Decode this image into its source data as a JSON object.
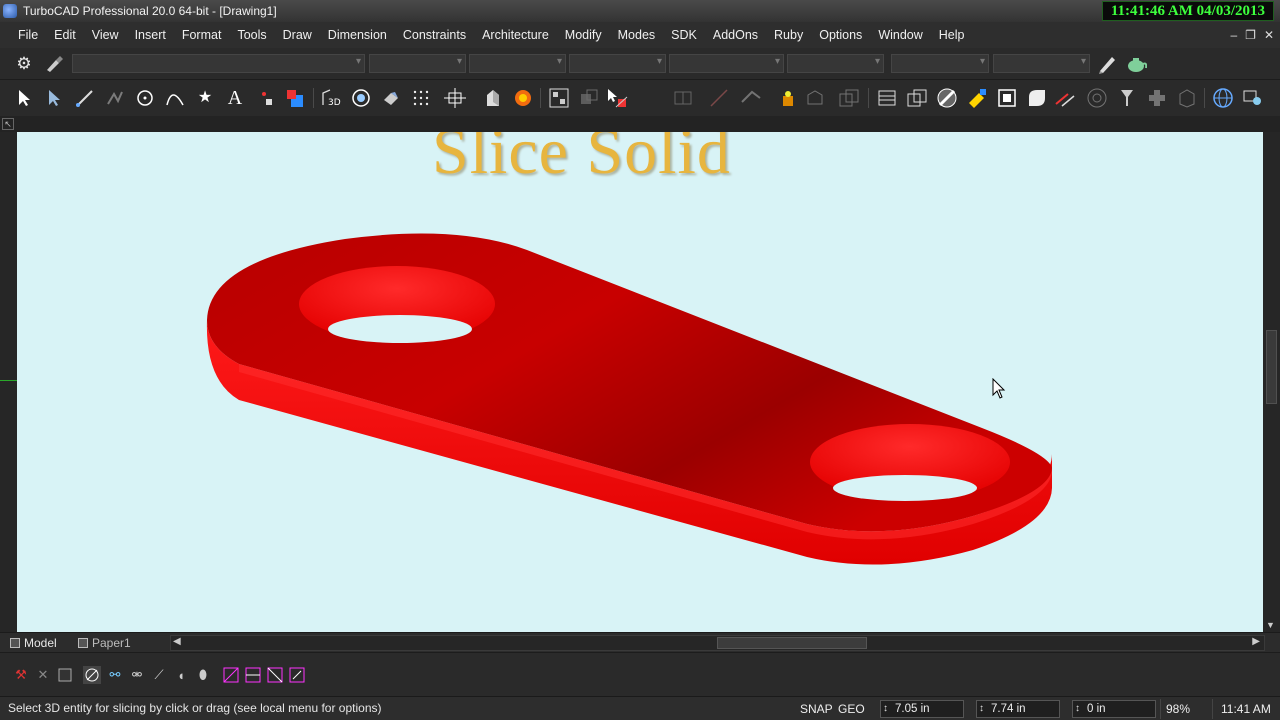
{
  "window": {
    "title": "TurboCAD Professional 20.0 64-bit - [Drawing1]"
  },
  "clock": {
    "text": "11:41:46 AM 04/03/2013"
  },
  "menu": [
    "File",
    "Edit",
    "View",
    "Insert",
    "Format",
    "Tools",
    "Draw",
    "Dimension",
    "Constraints",
    "Architecture",
    "Modify",
    "Modes",
    "SDK",
    "AddOns",
    "Ruby",
    "Options",
    "Window",
    "Help"
  ],
  "window_controls": {
    "minimize": "–",
    "restore": "❐",
    "close": "✕"
  },
  "overlay": {
    "caption": "Slice Solid"
  },
  "tabs": {
    "model": "Model",
    "paper": "Paper1"
  },
  "status": {
    "message": "Select 3D entity for slicing by click or drag (see local menu for options)",
    "snap": "SNAP",
    "geo": "GEO",
    "x": "7.05 in",
    "y": "7.74 in",
    "z": "0 in",
    "zoom": "98%",
    "time": "11:41 AM"
  },
  "colors": {
    "canvas": "#d8f3f6",
    "part": "#e60000",
    "caption": "#e7b53f",
    "clock_text": "#3dff3d"
  },
  "icons": {
    "property_toolbar": [
      "gear-icon",
      "brush-icon",
      "pencil-icon",
      "teapot-icon"
    ],
    "main_toolbar": [
      "select-arrow-icon",
      "edit-arrow-icon",
      "line-icon",
      "multiline-icon",
      "circle-icon",
      "curve-icon",
      "star-icon",
      "text-icon",
      "point-icon",
      "fill-icon",
      "view-3d-icon",
      "camera-target-icon",
      "render-icon",
      "grid-icon",
      "snap-icon",
      "shell-icon",
      "material-icon",
      "block-icon",
      "group-icon",
      "slice-icon",
      "boolean-icon",
      "measure-icon",
      "light-icon",
      "push-pull-icon",
      "layers-icon",
      "box-icon",
      "shaded-icon",
      "wireframe-icon",
      "hatch-icon",
      "zoom-window-icon",
      "blend-icon",
      "chamfer-icon",
      "bolt-icon",
      "plus-icon",
      "cube-icon",
      "globe-icon",
      "settings-icon"
    ],
    "bottom_toolbar": [
      "magnet-icon",
      "cross-icon",
      "square-icon",
      "snap-none-icon",
      "snap-vertex-icon",
      "snap-middle-icon",
      "snap-center-icon",
      "snap-quadrant-icon",
      "snap-tangent-icon",
      "snap-perpendicular-icon",
      "snap-grid-icon",
      "snap-intersection-icon",
      "snap-nearest-icon",
      "snap-apparent-icon"
    ]
  }
}
